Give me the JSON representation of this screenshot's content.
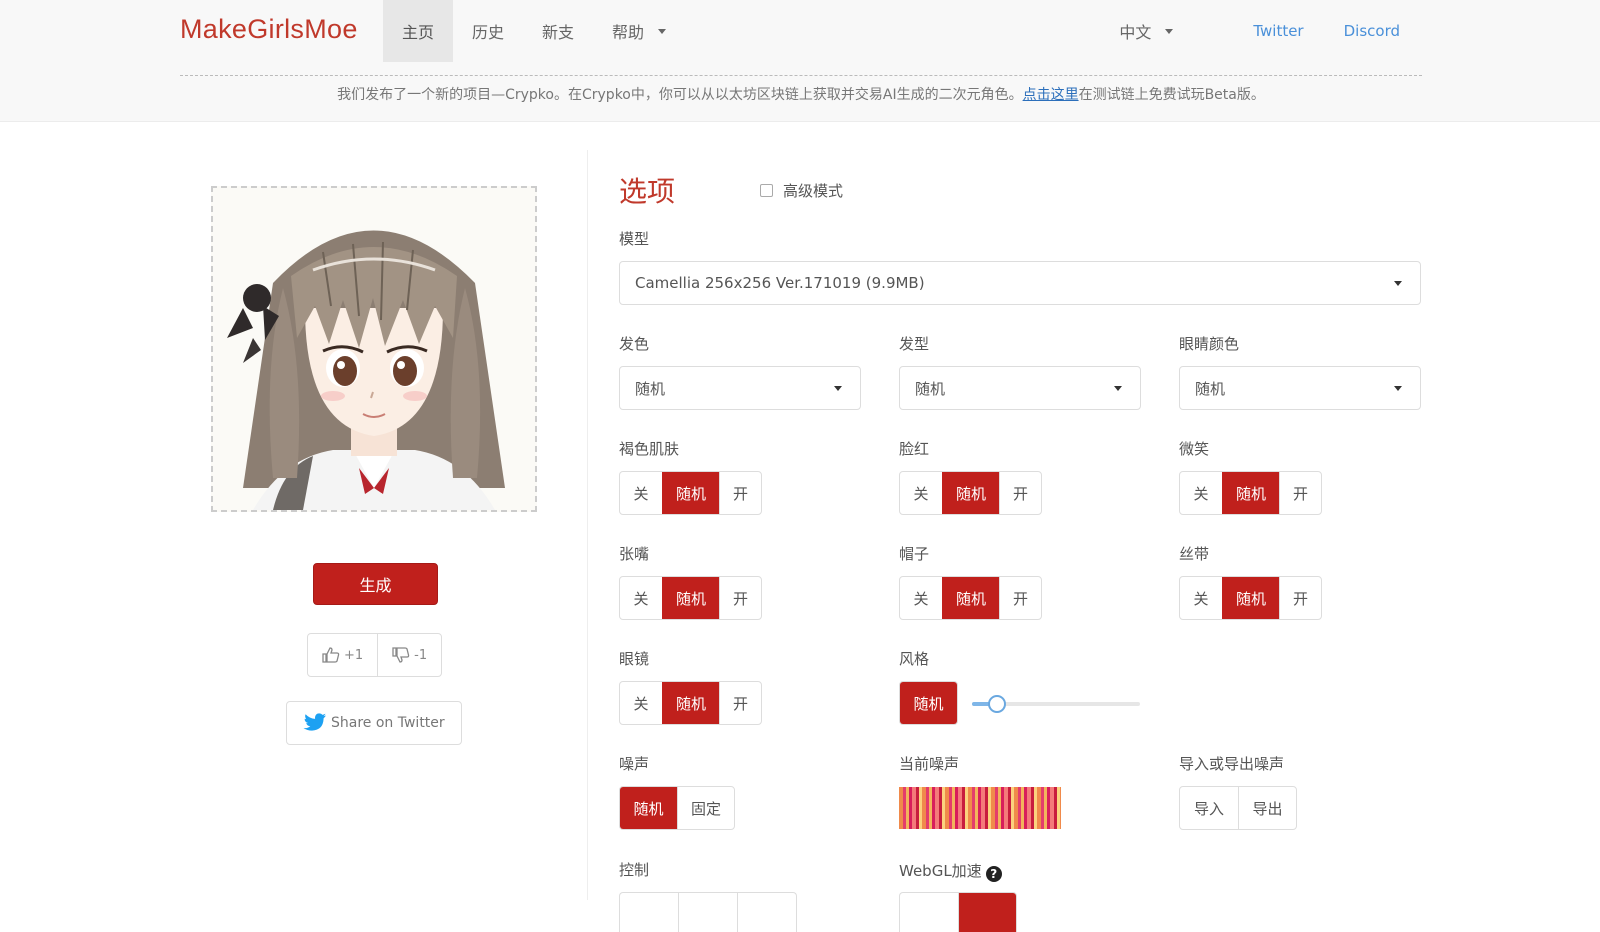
{
  "header": {
    "brand": "MakeGirlsMoe",
    "nav": [
      {
        "label": "主页",
        "active": true
      },
      {
        "label": "历史",
        "active": false
      },
      {
        "label": "新支",
        "active": false
      },
      {
        "label": "帮助",
        "active": false,
        "dropdown": true
      }
    ],
    "language": "中文",
    "links": [
      "Twitter",
      "Discord"
    ],
    "announcement": {
      "text": "我们发布了一个新的项目—Crypko。在Crypko中，你可以从以太坊区块链上获取并交易AI生成的二次元角色。",
      "link_text": "点击这里",
      "tail": "在测试链上免费试玩Beta版。"
    }
  },
  "left": {
    "generate_label": "生成",
    "upvote_label": "+1",
    "downvote_label": "-1",
    "share_label": "Share on Twitter"
  },
  "options": {
    "title": "选项",
    "advanced_label": "高级模式",
    "advanced_checked": false,
    "model": {
      "label": "模型",
      "value": "Camellia 256x256 Ver.171019 (9.9MB)"
    },
    "selects": [
      {
        "label": "发色",
        "value": "随机"
      },
      {
        "label": "发型",
        "value": "随机"
      },
      {
        "label": "眼睛颜色",
        "value": "随机"
      }
    ],
    "toggles": [
      {
        "label": "褐色肌肤",
        "options": [
          "关",
          "随机",
          "开"
        ],
        "selected": 1
      },
      {
        "label": "脸红",
        "options": [
          "关",
          "随机",
          "开"
        ],
        "selected": 1
      },
      {
        "label": "微笑",
        "options": [
          "关",
          "随机",
          "开"
        ],
        "selected": 1
      },
      {
        "label": "张嘴",
        "options": [
          "关",
          "随机",
          "开"
        ],
        "selected": 1
      },
      {
        "label": "帽子",
        "options": [
          "关",
          "随机",
          "开"
        ],
        "selected": 1
      },
      {
        "label": "丝带",
        "options": [
          "关",
          "随机",
          "开"
        ],
        "selected": 1
      },
      {
        "label": "眼镜",
        "options": [
          "关",
          "随机",
          "开"
        ],
        "selected": 1
      }
    ],
    "style": {
      "label": "风格",
      "button": "随机",
      "slider_value": 0.15
    },
    "noise": {
      "label": "噪声",
      "options": [
        "随机",
        "固定"
      ],
      "selected": 0
    },
    "current_noise_label": "当前噪声",
    "import_export": {
      "label": "导入或导出噪声",
      "options": [
        "导入",
        "导出"
      ]
    },
    "control_label": "控制",
    "webgl_label": "WebGL加速",
    "help_glyph": "?"
  },
  "colors": {
    "accent": "#c0201c",
    "brand": "#c0392b",
    "link": "#4a90d9",
    "header_bg": "#f8f8f8"
  }
}
